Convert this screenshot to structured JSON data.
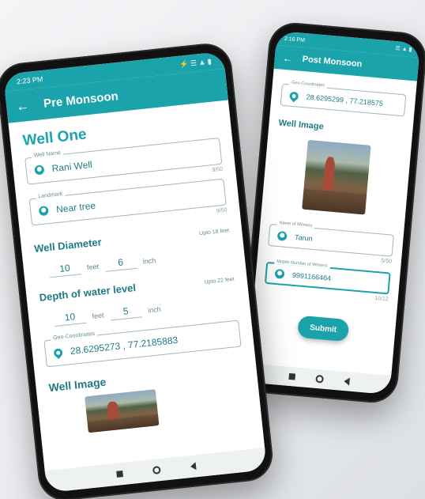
{
  "front": {
    "status_time": "2:23 PM",
    "status_icons": "⚡ ☰ ▲ ▮",
    "title": "Pre Monsoon",
    "heading": "Well One",
    "well_name": {
      "label": "Well Name",
      "value": "Rani Well",
      "counter": "9/50"
    },
    "landmark": {
      "label": "Landmark",
      "value": "Near tree",
      "counter": "9/50"
    },
    "diameter": {
      "title": "Well Diameter",
      "limit": "Upto 18 feet",
      "feet": "10",
      "feet_unit": "feet",
      "inch": "6",
      "inch_unit": "inch"
    },
    "depth": {
      "title": "Depth of water level",
      "limit": "Upto 22 feet",
      "feet": "10",
      "feet_unit": "feet",
      "inch": "5",
      "inch_unit": "inch"
    },
    "geo": {
      "label": "Geo-Coordinates",
      "value": "28.6295273 , 77.2185883"
    },
    "image_heading": "Well Image"
  },
  "back": {
    "status_time": "2:16 PM",
    "status_icons": "☰ ▲ ▮",
    "title": "Post Monsoon",
    "geo": {
      "label": "Geo-Coordinates",
      "value": "28.6295299 , 77.218575"
    },
    "image_heading": "Well Image",
    "witness": {
      "label": "Name of Witness",
      "value": "Tarun",
      "counter": "5/50"
    },
    "mobile": {
      "label": "Mobile Number of Witness",
      "value": "9991166464",
      "counter": "10/12"
    },
    "submit_label": "Submit"
  },
  "colors": {
    "accent": "#1ba3ac",
    "text": "#1e7a84"
  },
  "icons": [
    "back-arrow-icon",
    "person-icon",
    "location-pin-icon",
    "nav-recents-icon",
    "nav-home-icon",
    "nav-back-icon"
  ]
}
